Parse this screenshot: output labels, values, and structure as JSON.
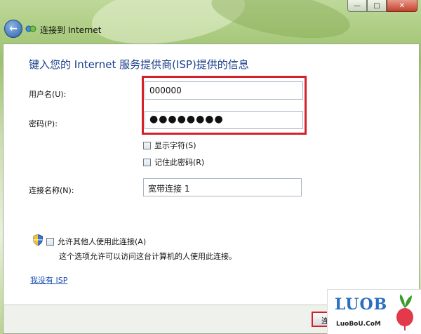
{
  "window": {
    "caption_buttons": {
      "minimize": "—",
      "maximize": "□",
      "close": "✕"
    }
  },
  "nav": {
    "back_icon": "back-arrow-icon",
    "title": "连接到 Internet"
  },
  "main": {
    "heading": "键入您的 Internet 服务提供商(ISP)提供的信息",
    "username": {
      "label": "用户名(U):",
      "value": "000000"
    },
    "password": {
      "label": "密码(P):",
      "value": "●●●●●●●●"
    },
    "show_chars": {
      "label": "显示字符(S)",
      "checked": false
    },
    "remember_pwd": {
      "label": "记住此密码(R)",
      "checked": false
    },
    "connection_name": {
      "label": "连接名称(N):",
      "value": "宽带连接 1"
    },
    "allow_others": {
      "label": "允许其他人使用此连接(A)",
      "checked": false
    },
    "allow_note": "这个选项允许可以访问这台计算机的人使用此连接。",
    "no_isp_link": "我没有 ISP"
  },
  "footer": {
    "connect_label": "连接"
  },
  "watermark": {
    "brand": "LUOB",
    "site": "LuoBoU.CoM"
  },
  "colors": {
    "heading": "#1a3f8a",
    "highlight": "#d4202a",
    "link": "#1a4fb0"
  }
}
